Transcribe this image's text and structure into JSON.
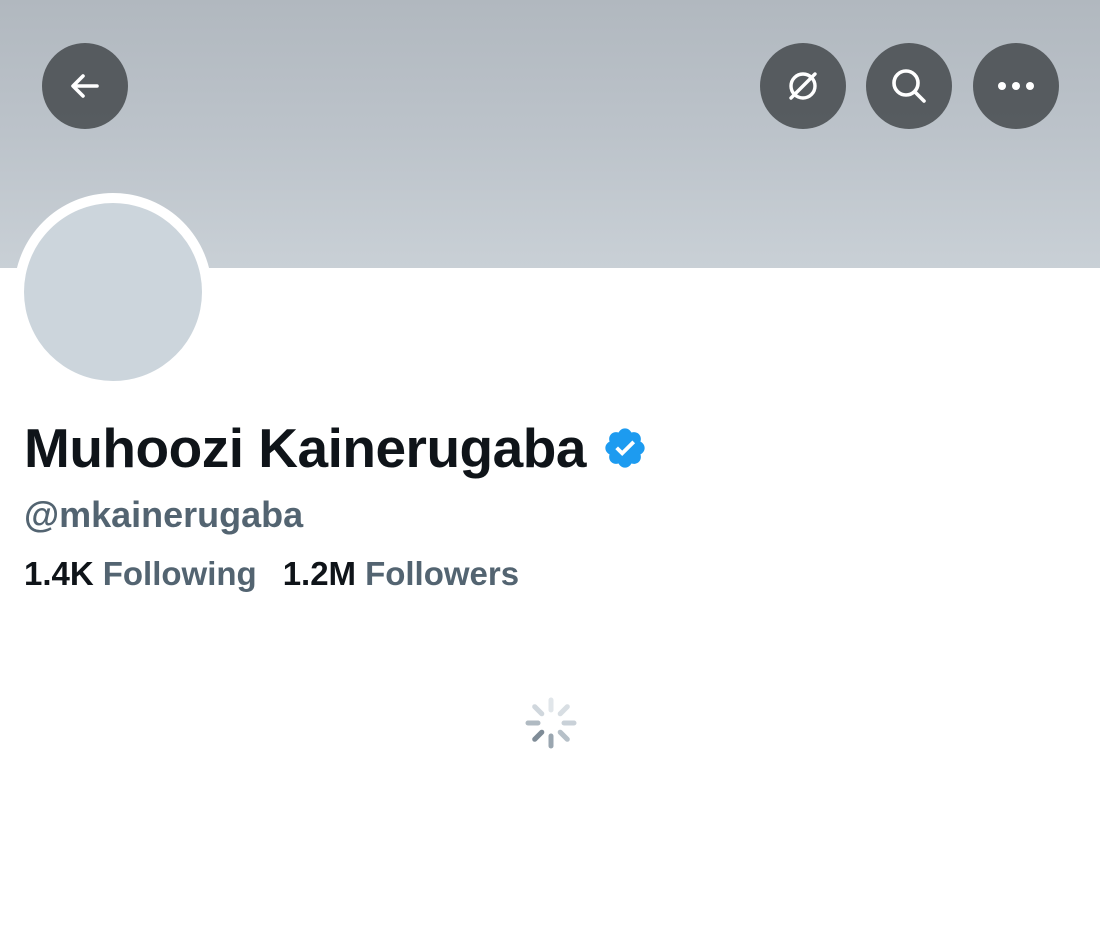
{
  "profile": {
    "display_name": "Muhoozi Kainerugaba",
    "handle": "@mkainerugaba",
    "verified": true,
    "following_count": "1.4K",
    "following_label": "Following",
    "followers_count": "1.2M",
    "followers_label": "Followers"
  },
  "header_actions": {
    "back_icon": "arrow-left-icon",
    "grok_icon": "grok-icon",
    "search_icon": "search-icon",
    "more_icon": "more-horizontal-icon"
  },
  "colors": {
    "text_primary": "#0f1419",
    "text_secondary": "#536471",
    "verified_blue": "#1d9bf0",
    "avatar_placeholder": "#ccd5dc",
    "button_background": "#464a4e"
  },
  "status": {
    "loading": true
  }
}
